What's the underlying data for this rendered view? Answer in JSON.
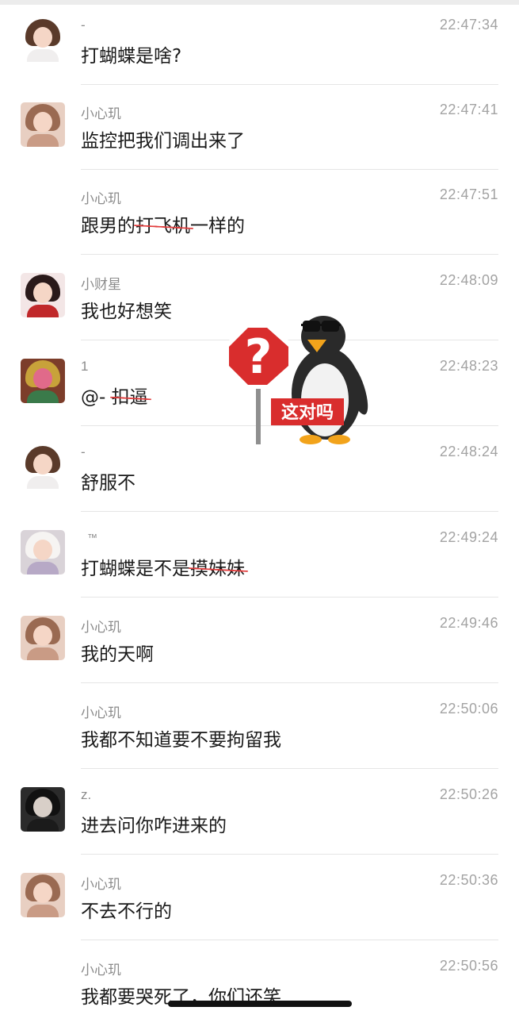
{
  "chat": {
    "messages": [
      {
        "name": "-",
        "time": "22:47:34",
        "text": "打蝴蝶是啥?",
        "avatar": "cartoon-girl-avatar"
      },
      {
        "name": "小心玑",
        "time": "22:47:41",
        "text": "监控把我们调出来了",
        "avatar": "girl-photo-avatar"
      },
      {
        "name": "小心玑",
        "time": "22:47:51",
        "pre": "跟男的",
        "struck": "打飞机",
        "post": "一样的",
        "avatar": ""
      },
      {
        "name": "小财星",
        "time": "22:48:09",
        "text": "我也好想笑",
        "avatar": "dark-hair-girl-avatar"
      },
      {
        "name": "1",
        "time": "22:48:23",
        "pre": "@- ",
        "struck": "扣逼",
        "post": "",
        "avatar": "colorful-avatar"
      },
      {
        "name": "-",
        "time": "22:48:24",
        "text": "舒服不",
        "avatar": "cartoon-girl-avatar"
      },
      {
        "name": "™",
        "time": "22:49:24",
        "pre": "打蝴蝶是不是",
        "struck": "摸妹妹",
        "post": "",
        "avatar": "white-hat-avatar"
      },
      {
        "name": "小心玑",
        "time": "22:49:46",
        "text": "我的天啊",
        "avatar": "girl-photo-avatar"
      },
      {
        "name": "小心玑",
        "time": "22:50:06",
        "text": "我都不知道要不要拘留我",
        "avatar": ""
      },
      {
        "name": "z.",
        "time": "22:50:26",
        "text": "进去问你咋进来的",
        "avatar": "dark-photo-avatar"
      },
      {
        "name": "小心玑",
        "time": "22:50:36",
        "text": "不去不行的",
        "avatar": "girl-photo-avatar"
      },
      {
        "name": "小心玑",
        "time": "22:50:56",
        "text": "我都要哭死了，你们还笑",
        "avatar": ""
      }
    ]
  },
  "sticker": {
    "caption": "这对吗",
    "icon": "penguin-question-sign-sticker",
    "question_mark": "?"
  },
  "colors": {
    "name": "#8b8b8b",
    "time": "#a3a3a3",
    "message": "#1a1a1a",
    "strike": "#e23b3b",
    "divider": "#e5e5e5"
  }
}
